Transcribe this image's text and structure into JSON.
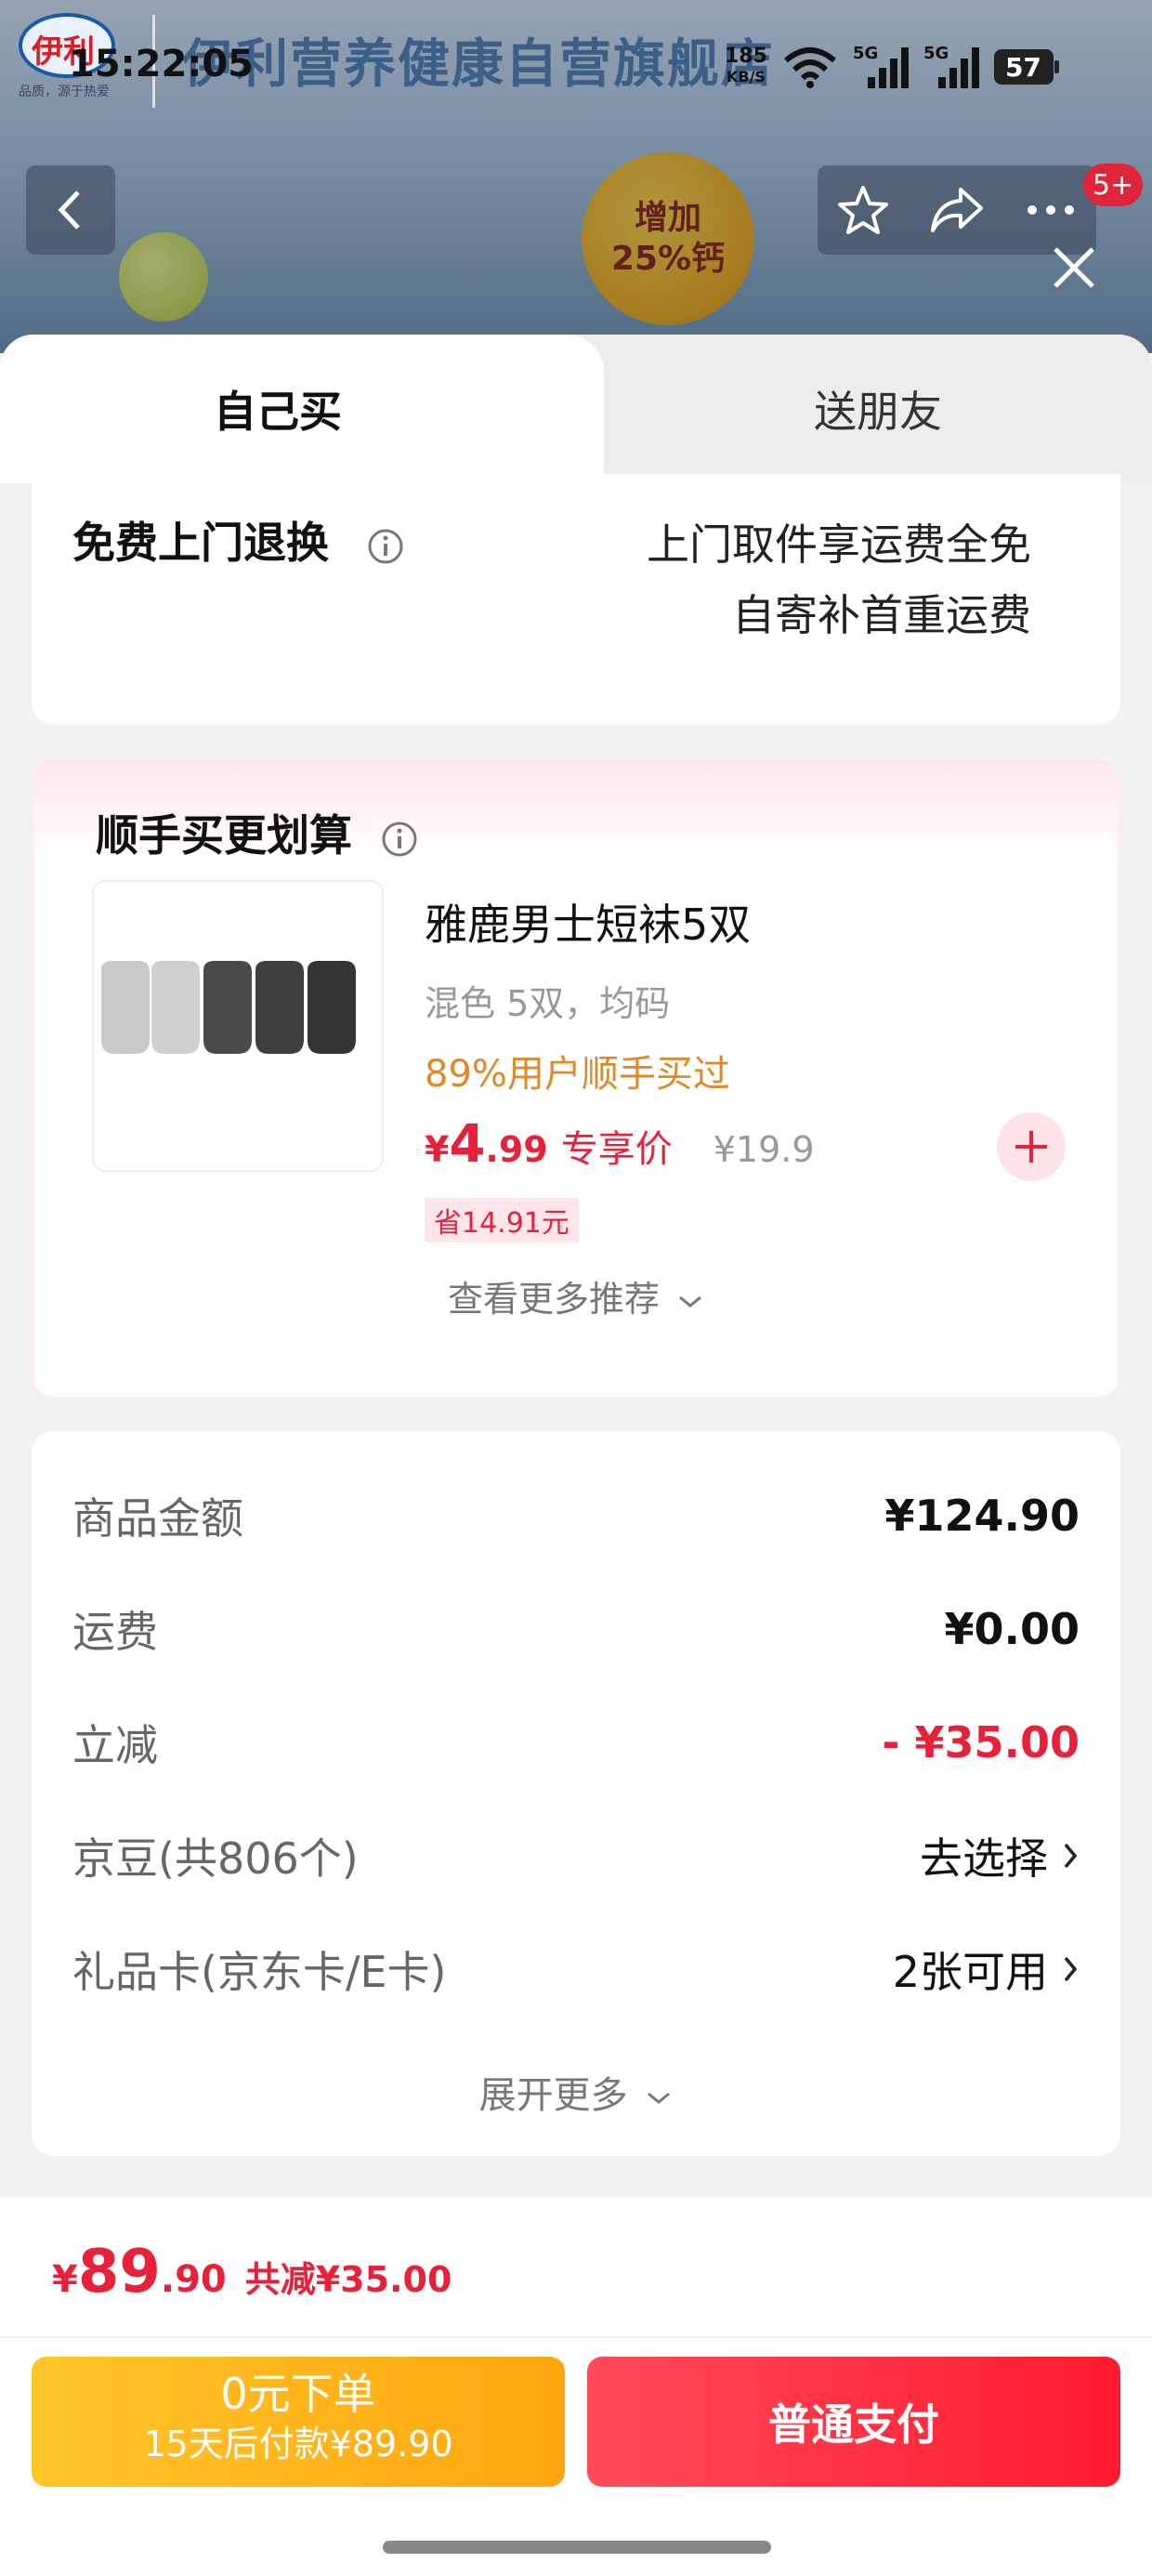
{
  "status_bar": {
    "time": "15:22:05",
    "net_speed": "185",
    "net_unit": "KB/S",
    "signal_tag_1": "5G",
    "signal_tag_2": "5G",
    "battery": "57"
  },
  "header": {
    "logo_text": "伊利",
    "logo_sub": "品质，源于热爱",
    "store_name": "伊利营养健康自营旗舰店",
    "promo_badge_line1": "增加",
    "promo_badge_line2": "25%钙",
    "message_badge": "5+"
  },
  "tabs": {
    "self": "自己买",
    "friend": "送朋友"
  },
  "return_service": {
    "title": "免费上门退换",
    "line1": "上门取件享运费全免",
    "line2": "自寄补首重运费"
  },
  "recommend": {
    "title": "顺手买更划算",
    "product_name": "雅鹿男士短袜5双",
    "spec": "混色 5双，均码",
    "buyers": "89%用户顺手买过",
    "price_yen": "¥",
    "price_int": "4",
    "price_dec": ".99",
    "price_label": "专享价",
    "original_price": "¥19.9",
    "save_tag": "省14.91元",
    "more": "查看更多推荐"
  },
  "fees": {
    "rows": [
      {
        "label": "商品金额",
        "value": "¥124.90"
      },
      {
        "label": "运费",
        "value": "¥0.00"
      },
      {
        "label": "立减",
        "value": "- ¥35.00"
      },
      {
        "label": "京豆(共806个)",
        "value": "去选择"
      },
      {
        "label": "礼品卡(京东卡/E卡)",
        "value": "2张可用"
      }
    ],
    "expand": "展开更多"
  },
  "footer": {
    "total_yen": "¥",
    "total_int": "89",
    "total_dec": ".90",
    "total_reduce": "共减¥35.00",
    "later_line1": "0元下单",
    "later_line2": "15天后付款¥89.90",
    "pay_label": "普通支付"
  },
  "colors": {
    "accent_red": "#e8213a",
    "pay_button": "#ff1a2e",
    "later_button": "#ffb21c",
    "buyers_orange": "#e0892a"
  }
}
